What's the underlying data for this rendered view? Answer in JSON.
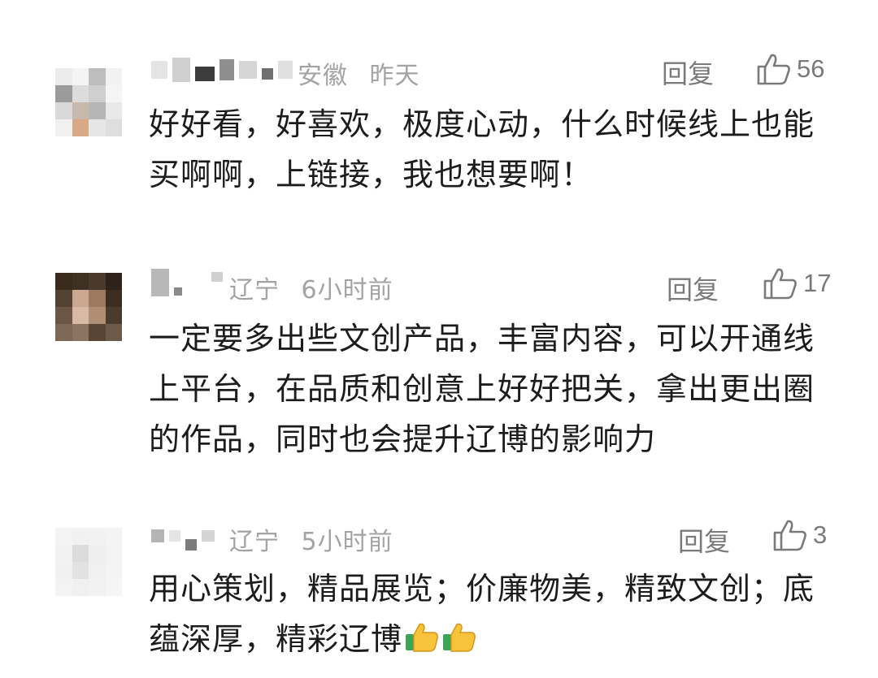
{
  "comments": [
    {
      "location": "安徽",
      "time": "昨天",
      "reply_label": "回复",
      "likes": "56",
      "text": "好好看，好喜欢，极度心动，什么时候线上也能买啊啊，上链接，我也想要啊！",
      "emoji": []
    },
    {
      "location": "辽宁",
      "time": "6小时前",
      "reply_label": "回复",
      "likes": "17",
      "text": "一定要多出些文创产品，丰富内容，可以开通线上平台，在品质和创意上好好把关，拿出更出圈的作品，同时也会提升辽博的影响力",
      "emoji": []
    },
    {
      "location": "辽宁",
      "time": "5小时前",
      "reply_label": "回复",
      "likes": "3",
      "text": "用心策划，精品展览；价廉物美，精致文创；底蕴深厚，精彩辽博",
      "emoji": [
        "thumbs-up",
        "thumbs-up"
      ]
    }
  ],
  "icons": {
    "like": "thumbs-up-outline-icon",
    "emoji": "thumbs-up-emoji-icon"
  },
  "colors": {
    "meta": "#a3a3a3",
    "action": "#7a7a7a",
    "text": "#1c1c1c"
  }
}
